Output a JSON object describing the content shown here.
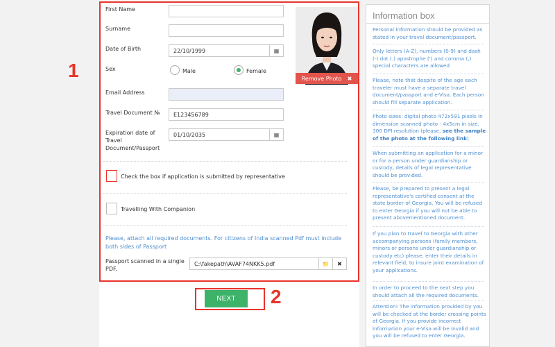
{
  "annotations": {
    "marker1": "1",
    "marker2": "2"
  },
  "form": {
    "first_name": {
      "label": "First Name",
      "value": ""
    },
    "surname": {
      "label": "Surname",
      "value": ""
    },
    "dob": {
      "label": "Date of Birth",
      "value": "22/10/1999"
    },
    "sex": {
      "label": "Sex",
      "options": [
        "Male",
        "Female"
      ],
      "selected": "Female"
    },
    "email": {
      "label": "Email Address",
      "value": ""
    },
    "travel_doc": {
      "label": "Travel Document №",
      "value": "E123456789"
    },
    "expiration": {
      "label_lines": [
        "Expiration date of",
        "Travel",
        "Document/Passport"
      ],
      "value": "01/10/2035"
    },
    "representative": {
      "label": "Check the box if application is submitted by representative",
      "checked": false
    },
    "companion": {
      "label": "Travelling With Companion",
      "checked": false
    },
    "attach_note": "Please, attach all required documents. For citizens of India scanned Pdf must include both sides of Passport",
    "passport_file": {
      "label_lines": [
        "Passport scanned in a single",
        "PDF."
      ],
      "value": "C:\\fakepath\\AVAF74NKK5.pdf"
    },
    "remove_photo_label": "Remove Photo",
    "next_label": "NEXT"
  },
  "info_box": {
    "title": "Information box",
    "paragraphs": [
      "Personal information should be provided as stated in your travel document/passport.",
      "Only letters (A-Z), numbers (0-9) and dash (-) dot (.) apostrophe (') and comma (,) special characters are allowed",
      "Please, note that despite of the age each traveler must have a separate travel document/passport and e-Visa. Each person should fill separate application.",
      "Photo sizes: digital photo 472x591 pixels in dimension scanned photo - 4x5cm in size, 300 DPI resolution (please,",
      "When submitting an application for a minor or for a person under guardianship or custody, details of legal representative should be provided.",
      "Please, be prepared to present a legal representative's certified consent at the state border of Georgia. You will be refused to enter Georgia if you will not be able to present abovementioned document.",
      "If you plan to travel to Georgia with other accompanying persons (family members, minors or persons under guardianship or custody etc) please, enter their details in relevant field, to insure joint examination of your applications.",
      "In order to proceed to the next step you should attach all the required documents.",
      "Attention! The information provided by you will be checked at the border crossing points of Georgia. If you provide incorrect information your e-Visa will be invalid and you will be refused to enter Georgia."
    ],
    "photo_link": "see the sample of the photo at the following link",
    "photo_tail": ")"
  },
  "colors": {
    "accent_red": "#e8342b",
    "green": "#3db36a",
    "info_blue": "#4f8fd0"
  }
}
